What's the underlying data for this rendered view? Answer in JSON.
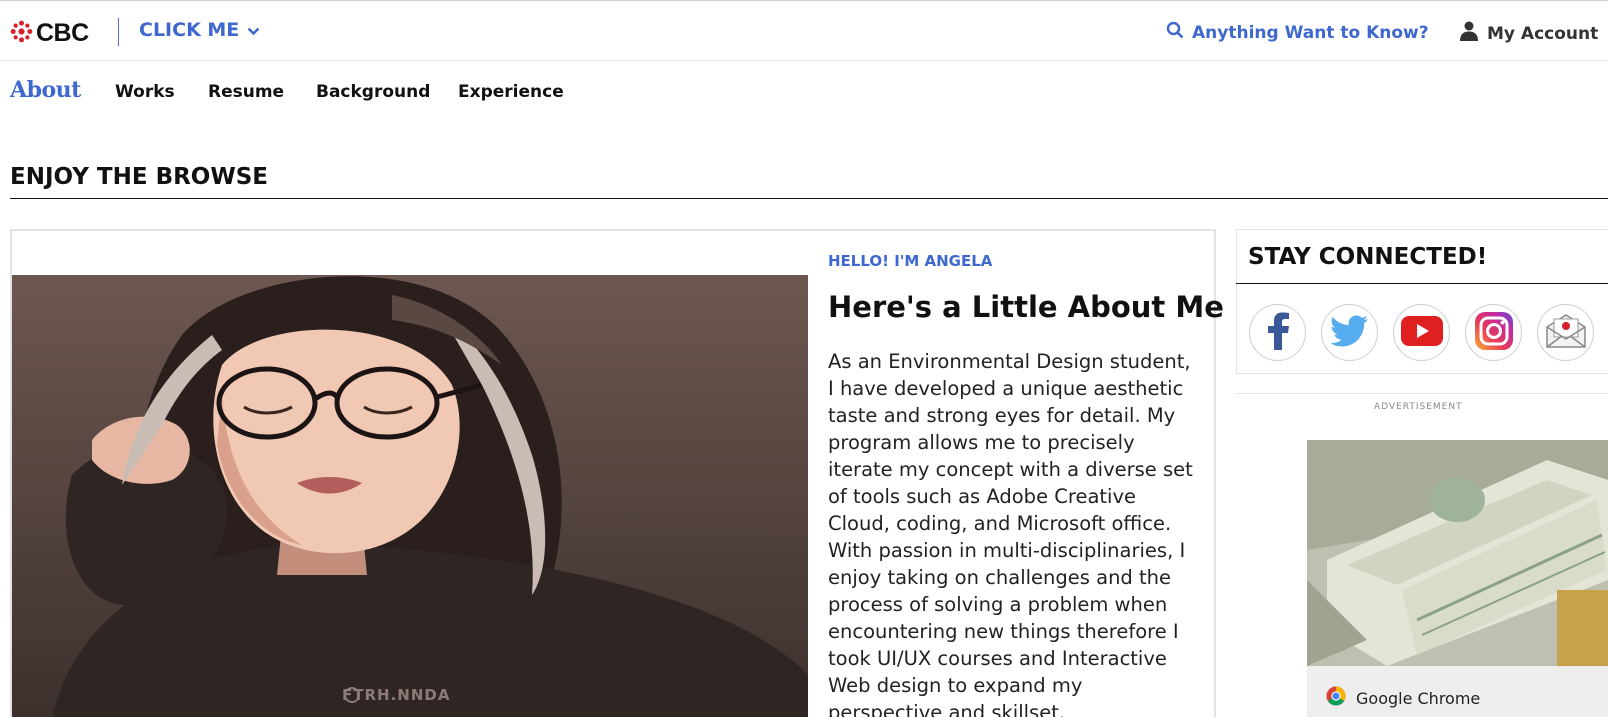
{
  "header": {
    "logo_text": "CBC",
    "click_me": "CLICK ME",
    "search_label": "Anything Want to Know?",
    "account_label": "My Account"
  },
  "nav": {
    "items": [
      {
        "label": "About",
        "active": true
      },
      {
        "label": "Works"
      },
      {
        "label": "Resume"
      },
      {
        "label": "Background"
      },
      {
        "label": "Experience"
      }
    ]
  },
  "section": {
    "title": "ENJOY THE BROWSE"
  },
  "about": {
    "photo_watermark": "FTRH.NNDA",
    "eyebrow": "HELLO! I'M ANGELA",
    "headline": "Here's a Little About Me",
    "body": "As an Environmental Design student, I have developed a unique aesthetic taste and strong eyes for detail. My program allows me to precisely iterate my concept with a diverse set of tools such as Adobe Creative Cloud, coding, and Microsoft office. With passion in multi-disciplinaries, I enjoy taking on challenges and the process of solving a problem when encountering new things therefore I took UI/UX courses and Interactive Web design to expand my perspective and skillset."
  },
  "sidebar": {
    "title": "STAY CONNECTED!",
    "social": [
      "facebook-icon",
      "twitter-icon",
      "youtube-icon",
      "instagram-icon",
      "mail-icon"
    ],
    "ad_label": "ADVERTISEMENT",
    "ad_footer": "Google Chrome"
  },
  "colors": {
    "accent": "#3f68cf",
    "cbc_red": "#d6202a",
    "text": "#111111"
  }
}
